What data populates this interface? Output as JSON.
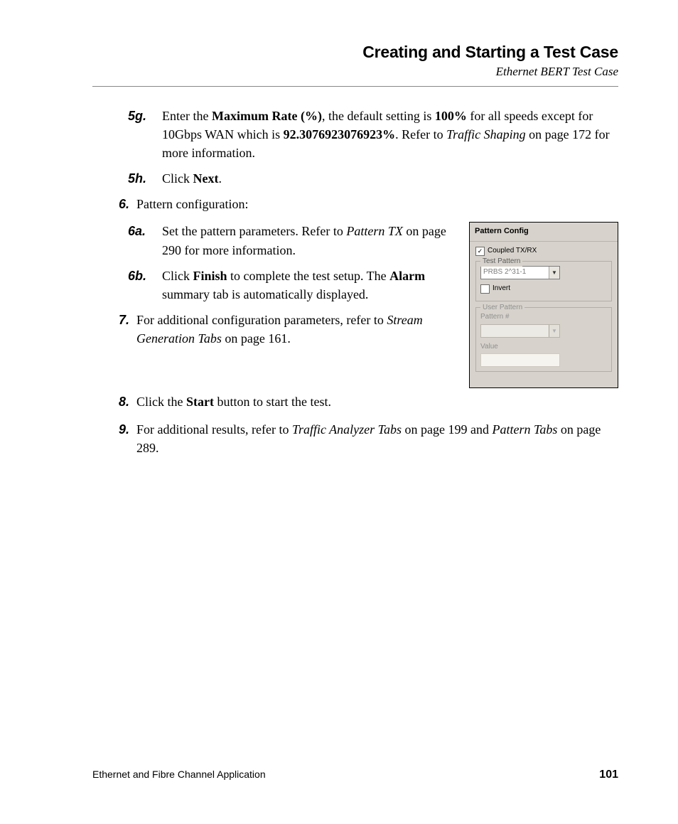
{
  "header": {
    "title": "Creating and Starting a Test Case",
    "subtitle": "Ethernet BERT Test Case"
  },
  "steps": {
    "s5g_num": "5g.",
    "s5g_a": "Enter the ",
    "s5g_b": "Maximum Rate (%)",
    "s5g_c": ", the default setting is ",
    "s5g_d": "100%",
    "s5g_e": " for all speeds except for 10Gbps WAN which is ",
    "s5g_f": "92.3076923076923%",
    "s5g_g": ". Refer to ",
    "s5g_h": "Traffic Shaping",
    "s5g_i": " on page 172 for more information.",
    "s5h_num": "5h.",
    "s5h_a": "Click ",
    "s5h_b": "Next",
    "s5h_c": ".",
    "s6_num": "6.",
    "s6_text": "Pattern configuration:",
    "s6a_num": "6a.",
    "s6a_a": "Set the pattern parameters. Refer to ",
    "s6a_b": "Pattern TX",
    "s6a_c": " on page 290 for more information.",
    "s6b_num": "6b.",
    "s6b_a": "Click ",
    "s6b_b": "Finish",
    "s6b_c": " to complete the test setup. The ",
    "s6b_d": "Alarm",
    "s6b_e": " summary tab is automatically displayed.",
    "s7_num": "7.",
    "s7_a": "For additional configuration parameters, refer to ",
    "s7_b": "Stream Generation Tabs",
    "s7_c": " on page 161.",
    "s8_num": "8.",
    "s8_a": "Click the ",
    "s8_b": "Start",
    "s8_c": " button to start the test.",
    "s9_num": "9.",
    "s9_a": "For additional results, refer to ",
    "s9_b": "Traffic Analyzer Tabs",
    "s9_c": " on page 199 and ",
    "s9_d": "Pattern Tabs",
    "s9_e": " on page 289."
  },
  "panel": {
    "title": "Pattern Config",
    "coupled_label": "Coupled TX/RX",
    "coupled_checked": "✓",
    "test_pattern_legend": "Test Pattern",
    "test_pattern_value": "PRBS 2^31-1",
    "invert_label": "Invert",
    "user_pattern_legend": "User Pattern",
    "pattern_num_label": "Pattern #",
    "value_label": "Value"
  },
  "footer": {
    "left": "Ethernet and Fibre Channel Application",
    "page": "101"
  }
}
